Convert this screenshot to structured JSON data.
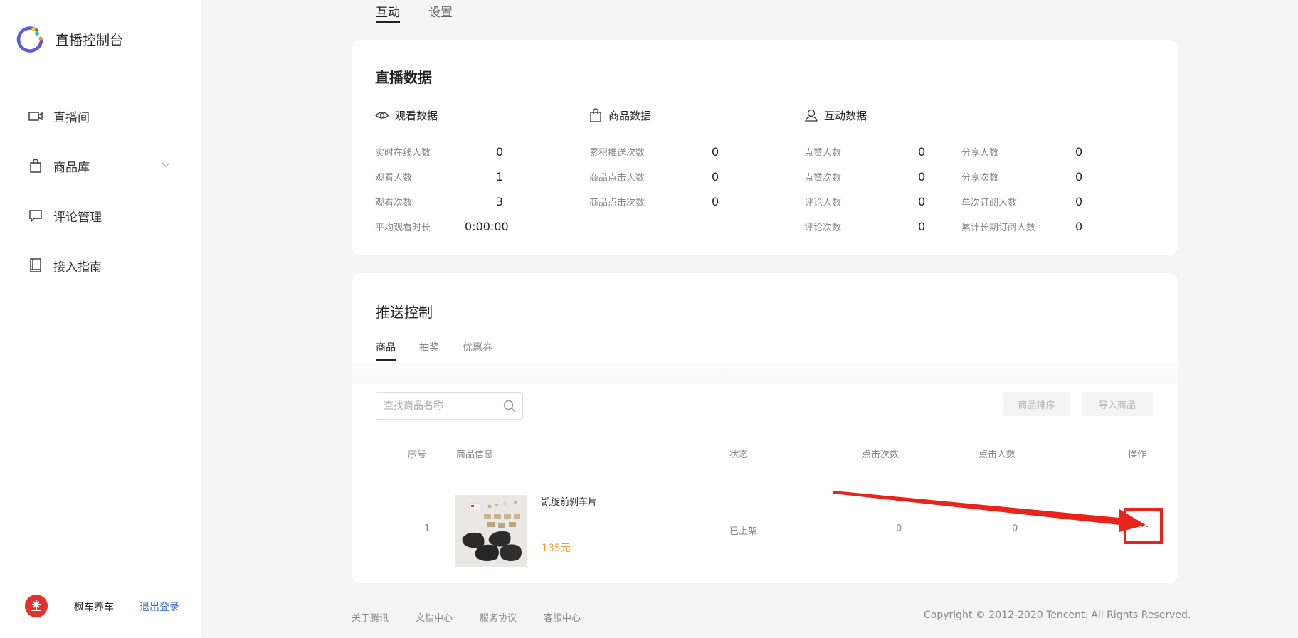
{
  "app": {
    "title": "直播控制台",
    "logo_icon": "brand-logo-icon"
  },
  "sidebar": {
    "items": [
      {
        "label": "直播间",
        "icon": "video-camera-icon"
      },
      {
        "label": "商品库",
        "icon": "shopping-bag-icon",
        "expandable": true
      },
      {
        "label": "评论管理",
        "icon": "comment-icon"
      },
      {
        "label": "接入指南",
        "icon": "book-icon"
      }
    ],
    "user": {
      "name": "枫车养车",
      "logout": "退出登录"
    }
  },
  "top_tabs": {
    "active": "互动",
    "items": [
      "互动",
      "设置"
    ]
  },
  "stats": {
    "title": "直播数据",
    "watch": {
      "title": "观看数据",
      "rows": [
        {
          "label": "实时在线人数",
          "value": "0"
        },
        {
          "label": "观看人数",
          "value": "1"
        },
        {
          "label": "观看次数",
          "value": "3"
        },
        {
          "label": "平均观看时长",
          "value": "0:00:00"
        }
      ]
    },
    "goods": {
      "title": "商品数据",
      "rows": [
        {
          "label": "累积推送次数",
          "value": "0"
        },
        {
          "label": "商品点击人数",
          "value": "0"
        },
        {
          "label": "商品点击次数",
          "value": "0"
        }
      ]
    },
    "interact": {
      "title": "互动数据",
      "col1": [
        {
          "label": "点赞人数",
          "value": "0"
        },
        {
          "label": "点赞次数",
          "value": "0"
        },
        {
          "label": "评论人数",
          "value": "0"
        },
        {
          "label": "评论次数",
          "value": "0"
        }
      ],
      "col2": [
        {
          "label": "分享人数",
          "value": "0"
        },
        {
          "label": "分享次数",
          "value": "0"
        },
        {
          "label": "单次订阅人数",
          "value": "0"
        },
        {
          "label": "累计长期订阅人数",
          "value": "0"
        }
      ]
    }
  },
  "push": {
    "title": "推送控制",
    "tabs": [
      "商品",
      "抽奖",
      "优惠券"
    ],
    "search": {
      "placeholder": "查找商品名称",
      "value": ""
    },
    "buttons": {
      "sort": "商品排序",
      "import": "导入商品"
    },
    "columns": [
      "序号",
      "商品信息",
      "状态",
      "点击次数",
      "点击人数",
      "操作"
    ],
    "rows": [
      {
        "index": "1",
        "name": "凯旋前刹车片",
        "price": "135元",
        "status": "已上架",
        "clicks": "0",
        "users": "0",
        "action": "···"
      }
    ]
  },
  "footer": {
    "links": [
      "关于腾讯",
      "文档中心",
      "服务协议",
      "客服中心"
    ],
    "copyright": "Copyright © 2012-2020 Tencent. All Rights Reserved."
  },
  "colors": {
    "accent": "#3e6cc6",
    "price": "#f0a030",
    "annotation": "#e8231c",
    "avatar": "#e5312d"
  }
}
